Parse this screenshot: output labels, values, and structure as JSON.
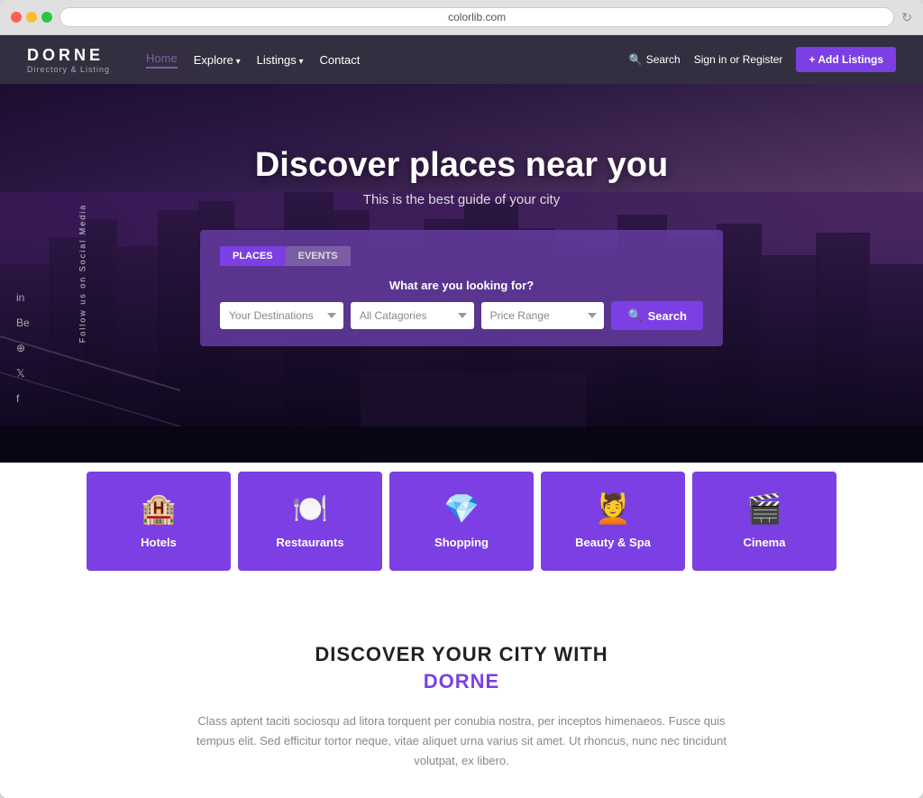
{
  "browser": {
    "url": "colorlib.com",
    "dots": [
      "red",
      "yellow",
      "green"
    ]
  },
  "navbar": {
    "logo": "DORNE",
    "logo_sub": "Directory & Listing",
    "links": [
      {
        "label": "Home",
        "active": true
      },
      {
        "label": "Explore",
        "has_arrow": true
      },
      {
        "label": "Listings",
        "has_arrow": true
      },
      {
        "label": "Contact"
      }
    ],
    "search_label": "Search",
    "signin_label": "Sign in or Register",
    "add_listing_label": "+ Add Listings"
  },
  "hero": {
    "title": "Discover places near you",
    "subtitle": "This is the best guide of your city",
    "social_label": "Follow us on Social Media",
    "social_icons": [
      "in",
      "Be",
      "⊕",
      "🐦",
      "f"
    ]
  },
  "search": {
    "question": "What are you looking for?",
    "tabs": [
      {
        "label": "PLACES",
        "active": true
      },
      {
        "label": "EVENTS",
        "active": false
      }
    ],
    "destination_placeholder": "Your Destinations",
    "categories_placeholder": "All Catagories",
    "price_placeholder": "Price Range",
    "search_btn": "Search"
  },
  "categories": [
    {
      "name": "Hotels",
      "icon": "🏨"
    },
    {
      "name": "Restaurants",
      "icon": "🍽️"
    },
    {
      "name": "Shopping",
      "icon": "💎"
    },
    {
      "name": "Beauty & Spa",
      "icon": "💆"
    },
    {
      "name": "Cinema",
      "icon": "🎬"
    }
  ],
  "discover": {
    "title": "DISCOVER YOUR CITY WITH",
    "brand": "DORNE",
    "description": "Class aptent taciti sociosqu ad litora torquent per conubia nostra, per inceptos himenaeos. Fusce quis tempus elit. Sed efficitur tortor neque, vitae aliquet urna varius sit amet. Ut rhoncus, nunc nec tincidunt volutpat, ex libero."
  }
}
